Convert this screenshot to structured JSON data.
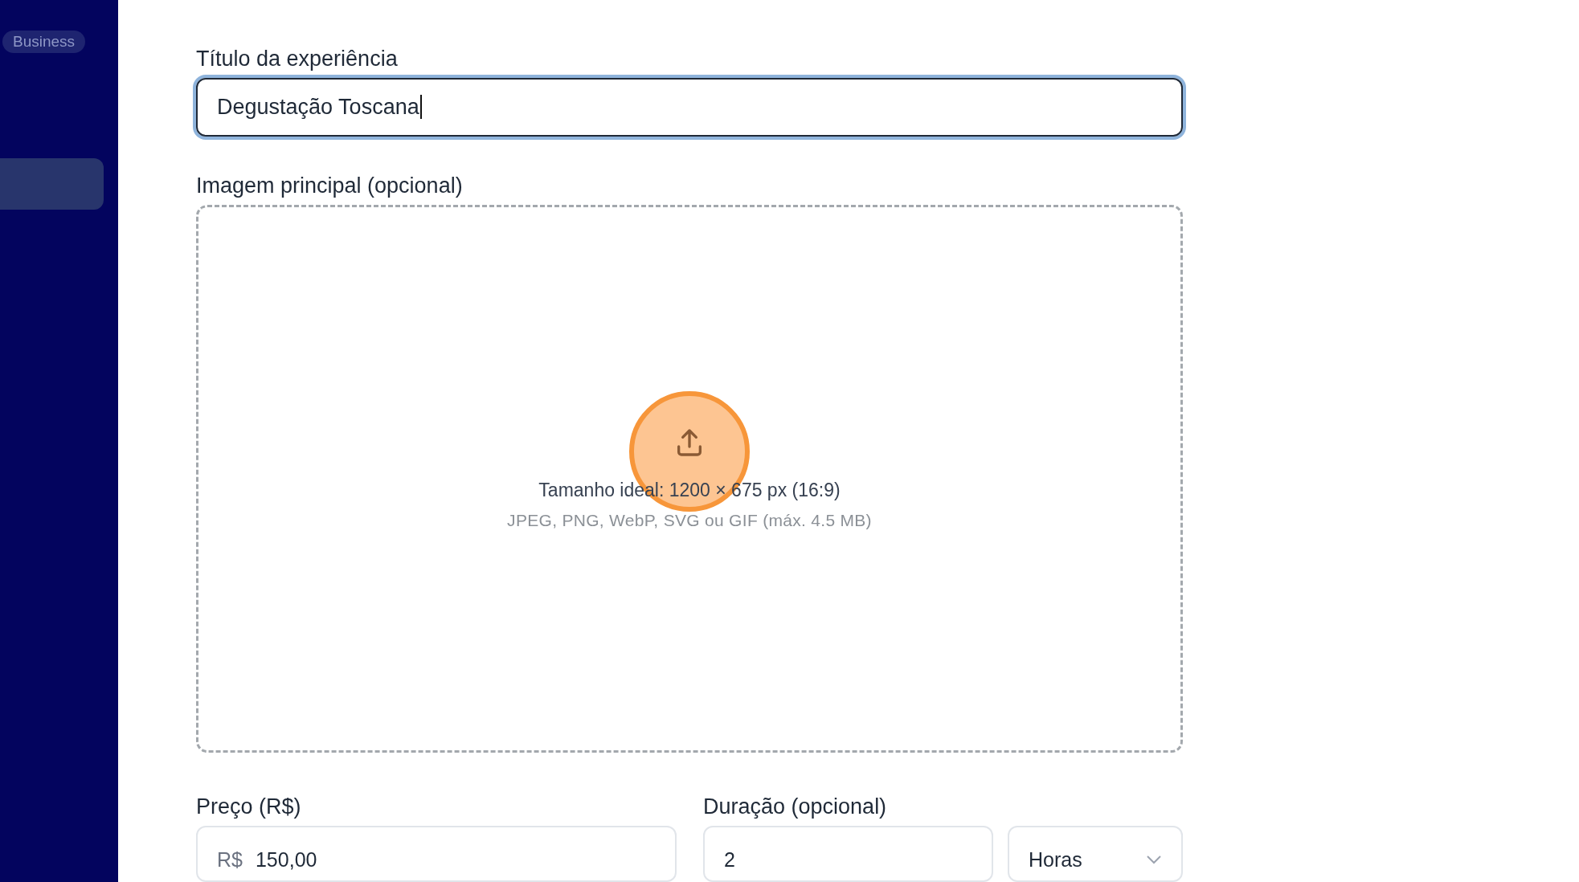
{
  "sidebar": {
    "badge": "Business",
    "items": [
      {
        "selected": true
      }
    ]
  },
  "title_field": {
    "label": "Título da experiência",
    "value": "Degustação Toscana",
    "focused": true
  },
  "image_upload": {
    "label": "Imagem principal (opcional)",
    "hint": "Tamanho ideal: 1200 × 675 px (16:9)",
    "formats": "JPEG, PNG, WebP, SVG ou GIF (máx. 4.5 MB)",
    "click_highlight": true
  },
  "price": {
    "label": "Preço (R$)",
    "prefix": "R$",
    "value": "150,00"
  },
  "duration": {
    "label": "Duração (opcional)",
    "value": "2",
    "unit": "Horas"
  }
}
